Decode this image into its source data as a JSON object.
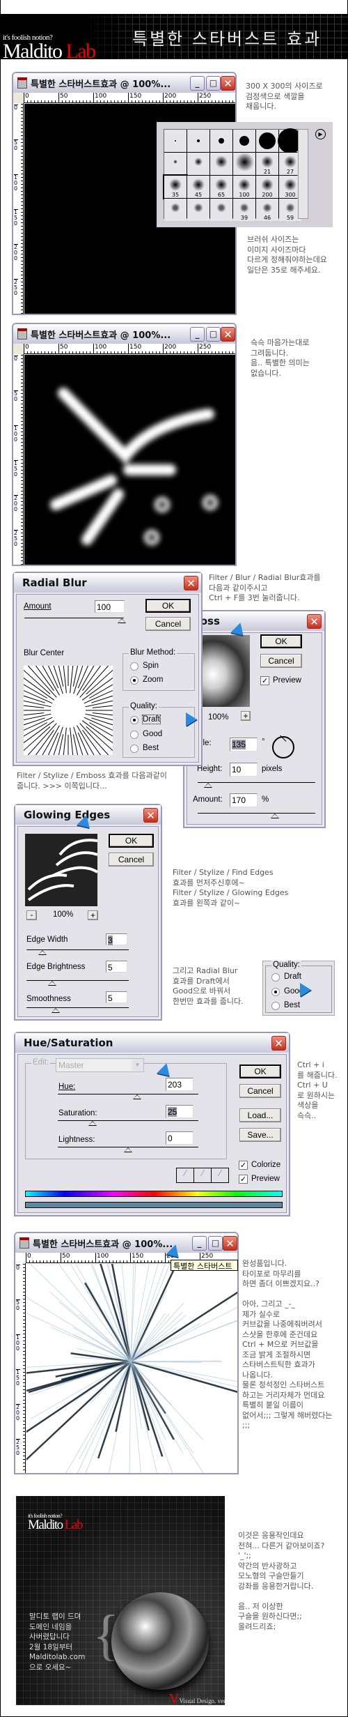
{
  "header": {
    "tagline": "it's foolish notion?",
    "brand_main": "Maldito",
    "brand_accent": "Lab",
    "title": "특별한 스타버스트 효과"
  },
  "window": {
    "title": "특별한 스타버스트효과 @ 100%...",
    "minimize": "_",
    "maximize": "□",
    "close": "✕",
    "hruler": [
      "0",
      "50",
      "100",
      "150",
      "200",
      "250"
    ],
    "vruler": [
      "0",
      "50",
      "100",
      "150",
      "200",
      "250"
    ]
  },
  "notes": {
    "n1": "300 X 300의 사이즈로\n검정색으로 색깔을\n채웁니다.",
    "n2": "브러쉬 사이즈는\n이미지 사이즈마다\n다르게 정해줘야하는데요\n일단은 35로 해주세요.",
    "n3": "슥슥 마음가는대로\n그려둡니다.\n음.. 특별한 의미는\n없습니다.",
    "n4": "Filter / Blur / Radial Blur효과를\n다음과 같이주시고\nCtrl + F를 3번 눌러줍니다.",
    "n5": "Filter / Stylize / Emboss 효과를 다음과같이\n줍니다. >>> 이쪽입니다...",
    "n6": "Filter / Stylize / Find Edges\n효과를 먼저주신후에~\nFilter / Stylize / Glowing Edges\n효과를 왼쪽과 같이~",
    "n7": "그리고 Radial Blur\n효과를 Draft에서\nGood으로 바꿔서\n한번만 효과를 줍니다.",
    "n8": "Ctrl + i\n를 해줍니다.\nCtrl + U\n로 원하시는\n색상을\n슥슥..",
    "n9": "완성품입니다.\n타이포로 마무리를\n하면 좀더 이쁘겠지요..?\n\n아아, 그리고 _-_\n제가 실수로\n커브값을 나중에줘버려서\n스샷을 한후에 준건데요\nCtrl + M으로 커브값을\n조금 밝게 조절하시면\n스타버스트틱한 효과가\n나옵니다.\n물론 정석정인 스타버스트\n하고는 거리자체가 먼데요\n특별히 붙일 이름이\n없어서;;; 그렇게 해버렸다는\n;;;",
    "n10": "이것은 응용작인데요\n전혀... 다른거 같아보이죠?\n'_';;\n약간의 반사광하고\n모노형의 구슬만들기\n강좌를 응용한거랍니다.\n\n음.. 저 이상한\n구슬을 원하신다면;;\n올려드리죠;"
  },
  "brushes": {
    "labels": [
      "",
      "",
      "",
      "",
      "",
      "",
      "",
      "",
      "",
      "",
      "21",
      "27",
      "35",
      "45",
      "65",
      "100",
      "200",
      "300",
      "",
      "",
      "",
      "39",
      "46",
      "59"
    ],
    "selected": "35"
  },
  "radial_blur": {
    "title": "Radial Blur",
    "amount_label": "Amount",
    "amount": "100",
    "ok": "OK",
    "cancel": "Cancel",
    "blur_center": "Blur Center",
    "method_label": "Blur Method:",
    "spin": "Spin",
    "zoom": "Zoom",
    "quality_label": "Quality:",
    "draft": "Draft",
    "good": "Good",
    "best": "Best",
    "method": "Zoom",
    "quality": "Draft",
    "amount_fraction": 0.98
  },
  "emboss": {
    "title": "boss",
    "ok": "OK",
    "cancel": "Cancel",
    "preview": "Preview",
    "zoom": "100%",
    "plus": "+",
    "angle_label": "Angle:",
    "angle": "135",
    "deg": "°",
    "height_label": "Height:",
    "height": "10",
    "pixels": "pixels",
    "amount_label": "Amount:",
    "amount": "170",
    "percent": "%"
  },
  "glowing_edges": {
    "title": "Glowing Edges",
    "ok": "OK",
    "cancel": "Cancel",
    "minus": "-",
    "zoom": "100%",
    "plus": "+",
    "edge_width_label": "Edge Width",
    "edge_width": "3",
    "edge_brightness_label": "Edge Brightness",
    "edge_brightness": "5",
    "smoothness_label": "Smoothness",
    "smoothness": "5"
  },
  "quality_box": {
    "label": "Quality:",
    "draft": "Draft",
    "good": "Good",
    "best": "Best",
    "selected": "Good"
  },
  "hue_sat": {
    "title": "Hue/Saturation",
    "edit_label": "Edit:",
    "edit_value": "Master",
    "hue_label": "Hue:",
    "hue": "203",
    "sat_label": "Saturation:",
    "sat": "25",
    "light_label": "Lightness:",
    "light": "0",
    "ok": "OK",
    "cancel": "Cancel",
    "load": "Load...",
    "save": "Save...",
    "colorize": "Colorize",
    "preview": "Preview",
    "colorize_checked": true,
    "preview_checked": true,
    "result_color": "#5e88a0"
  },
  "tooltip": "특별한 스타버스트",
  "promo": {
    "tagline": "it's foolish notion?",
    "brand_main": "Maldito",
    "brand_accent": "Lab",
    "text": "말디토 랩이 드뎌\n도메인 네임을\n사버렸답니다\n2월 18일부터\nMalditolab.com\n으로 오세요~",
    "signature": "Visual Design. ver"
  }
}
